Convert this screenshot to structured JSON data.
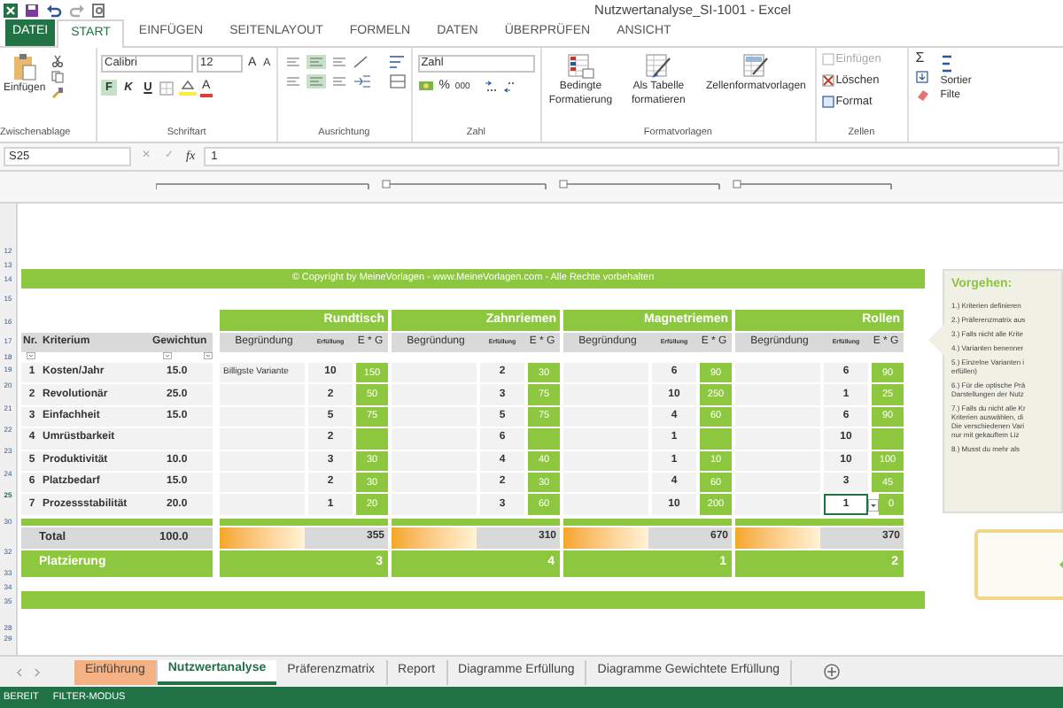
{
  "window": {
    "title": "Nutzwertanalyse_SI-1001 - Excel"
  },
  "ribbon_tabs": [
    {
      "label": "DATEI",
      "kind": "file",
      "selected": false
    },
    {
      "label": "START",
      "kind": "tab",
      "selected": true
    },
    {
      "label": "EINFÜGEN",
      "kind": "tab",
      "selected": false
    },
    {
      "label": "SEITENLAYOUT",
      "kind": "tab",
      "selected": false
    },
    {
      "label": "FORMELN",
      "kind": "tab",
      "selected": false
    },
    {
      "label": "DATEN",
      "kind": "tab",
      "selected": false
    },
    {
      "label": "ÜBERPRÜFEN",
      "kind": "tab",
      "selected": false
    },
    {
      "label": "ANSICHT",
      "kind": "tab",
      "selected": false
    }
  ],
  "ribbon": {
    "clipboard": {
      "paste": "Einfügen",
      "label": "Zwischenablage"
    },
    "font": {
      "name": "Calibri",
      "size": "12",
      "grow": "A",
      "shrink": "A",
      "bold": {
        "label": "F",
        "on": true
      },
      "italic": "K",
      "underline": "U",
      "font_color": "A",
      "label": "Schriftart"
    },
    "alignment": {
      "label": "Ausrichtung"
    },
    "number": {
      "format": "Zahl",
      "percent": "%",
      "thousands": "000",
      "label": "Zahl"
    },
    "styles": {
      "conditional": "Bedingte Formatierung",
      "table": "Als Tabelle formatieren",
      "cell_styles": "Zellenformatvorlagen",
      "label": "Formatvorlagen"
    },
    "cells": {
      "insert": {
        "label": "Einfügen",
        "disabled": true
      },
      "delete": {
        "label": "Löschen",
        "disabled": false
      },
      "format": {
        "label": "Format",
        "disabled": false
      },
      "label": "Zellen"
    },
    "editing": {
      "sum": "Σ",
      "sort": "Sortier",
      "filter": "Filte"
    }
  },
  "formula_bar": {
    "name_box": "S25",
    "cancel": "✕",
    "enter": "✓",
    "fx": "fx",
    "value": "1"
  },
  "row_numbers": [
    "12",
    "13",
    "14",
    "15",
    "16",
    "17",
    "18",
    "19",
    "20",
    "21",
    "22",
    "23",
    "24",
    "25",
    "30",
    "32",
    "33",
    "34",
    "35",
    "28",
    "29"
  ],
  "sheet": {
    "copyright": "© Copyright by MeineVorlagen - www.MeineVorlagen.com - Alle Rechte vorbehalten",
    "headers": {
      "nr": "Nr.",
      "criterion": "Kriterium",
      "weight": "Gewichtun"
    },
    "criteria": [
      {
        "nr": "1",
        "name": "Kosten/Jahr",
        "weight": "15.0"
      },
      {
        "nr": "2",
        "name": "Revolutionär",
        "weight": "25.0"
      },
      {
        "nr": "3",
        "name": "Einfachheit",
        "weight": "15.0"
      },
      {
        "nr": "4",
        "name": "Umrüstbarkeit"
      },
      {
        "nr": "5",
        "name": "Produktivität",
        "weight": "10.0"
      },
      {
        "nr": "6",
        "name": "Platzbedarf",
        "weight": "15.0"
      },
      {
        "nr": "7",
        "name": "Prozessstabilität",
        "weight": "20.0"
      }
    ],
    "total_label": "Total",
    "total_weight": "100.0",
    "placement_label": "Platzierung",
    "variants": [
      {
        "name": "Rundtisch",
        "subheaders": {
          "reason": "Begründung",
          "fulfilment": "Erfüllung",
          "score": "E * G"
        },
        "total": "355",
        "rank": "3",
        "cells": [
          {
            "reason": "Billigste Variante",
            "fulfilment": "10",
            "score": "150",
            "selected": false
          },
          {
            "fulfilment": "2",
            "score": "50",
            "selected": false
          },
          {
            "fulfilment": "5",
            "score": "75",
            "selected": false
          },
          {
            "fulfilment": "2",
            "selected": false
          },
          {
            "fulfilment": "3",
            "score": "30",
            "selected": false
          },
          {
            "fulfilment": "2",
            "score": "30",
            "selected": false
          },
          {
            "fulfilment": "1",
            "score": "20",
            "selected": false
          }
        ]
      },
      {
        "name": "Zahnriemen",
        "subheaders": {
          "reason": "Begründung",
          "fulfilment": "Erfüllung",
          "score": "E * G"
        },
        "total": "310",
        "rank": "4",
        "cells": [
          {
            "fulfilment": "2",
            "score": "30",
            "selected": false
          },
          {
            "fulfilment": "3",
            "score": "75",
            "selected": false
          },
          {
            "fulfilment": "5",
            "score": "75",
            "selected": false
          },
          {
            "fulfilment": "6",
            "selected": false
          },
          {
            "fulfilment": "4",
            "score": "40",
            "selected": false
          },
          {
            "fulfilment": "2",
            "score": "30",
            "selected": false
          },
          {
            "fulfilment": "3",
            "score": "60",
            "selected": false
          }
        ]
      },
      {
        "name": "Magnetriemen",
        "subheaders": {
          "reason": "Begründung",
          "fulfilment": "Erfüllung",
          "score": "E * G"
        },
        "total": "670",
        "rank": "1",
        "cells": [
          {
            "fulfilment": "6",
            "score": "90",
            "selected": false
          },
          {
            "fulfilment": "10",
            "score": "250",
            "selected": false
          },
          {
            "fulfilment": "4",
            "score": "60",
            "selected": false
          },
          {
            "fulfilment": "1",
            "selected": false
          },
          {
            "fulfilment": "1",
            "score": "10",
            "selected": false
          },
          {
            "fulfilment": "4",
            "score": "60",
            "selected": false
          },
          {
            "fulfilment": "10",
            "score": "200",
            "selected": false
          }
        ]
      },
      {
        "name": "Rollen",
        "subheaders": {
          "reason": "Begründung",
          "fulfilment": "Erfüllung",
          "score": "E * G"
        },
        "total": "370",
        "rank": "2",
        "cells": [
          {
            "fulfilment": "6",
            "score": "90",
            "selected": false
          },
          {
            "fulfilment": "1",
            "score": "25",
            "selected": false
          },
          {
            "fulfilment": "6",
            "score": "90",
            "selected": false
          },
          {
            "fulfilment": "10",
            "selected": false
          },
          {
            "fulfilment": "10",
            "score": "100",
            "selected": false
          },
          {
            "fulfilment": "3",
            "score": "45",
            "selected": false
          },
          {
            "fulfilment": "1",
            "score": "0",
            "selected": true
          }
        ]
      }
    ]
  },
  "side_panel": {
    "title": "Vorgehen:",
    "steps": [
      "1.) Kriterien definieren",
      "2.) Präferenzmatrix aus",
      "3.) Falls nicht alle Krite",
      "4.) Varianten benenner",
      "5.) Einzelne Varianten i\nerfüllen)",
      "6.) Für die optische Prä\nDarstellungen der Nutz",
      "7.) Falls du nicht alle Kr\nKriterien auswählen, di\nDie verschiedenen Vari\nnur mit gekauftem Liz",
      "8.) Musst du mehr als"
    ]
  },
  "sheet_tabs": [
    {
      "label": "Einführung",
      "selected": false,
      "color": "#f4b183"
    },
    {
      "label": "Nutzwertanalyse",
      "selected": true
    },
    {
      "label": "Präferenzmatrix",
      "selected": false
    },
    {
      "label": "Report",
      "selected": false
    },
    {
      "label": "Diagramme Erfüllung",
      "selected": false
    },
    {
      "label": "Diagramme Gewichtete Erfüllung",
      "selected": false
    }
  ],
  "status_bar": [
    "BEREIT",
    "FILTER-MODUS"
  ]
}
